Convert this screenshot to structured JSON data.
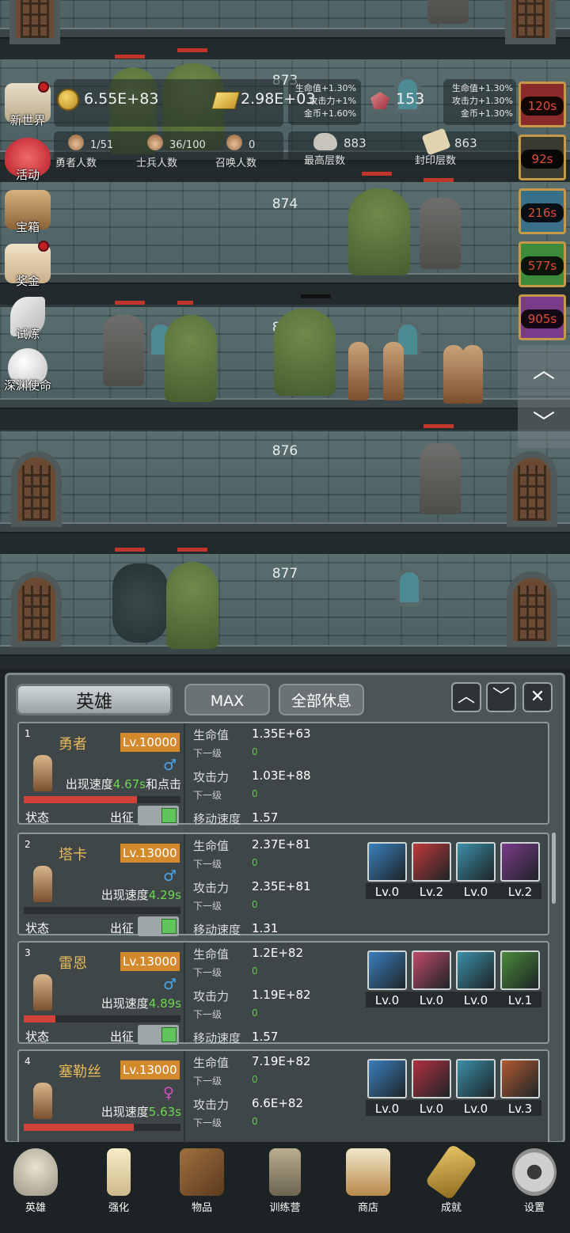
{
  "floors": [
    {
      "number": ""
    },
    {
      "number": "873"
    },
    {
      "number": "874"
    },
    {
      "number": "875"
    },
    {
      "number": "876"
    },
    {
      "number": "877"
    }
  ],
  "stats": {
    "gold": "6.55E+83",
    "goldbar": "2.98E+03",
    "goldbar_bonus": [
      "生命值+1.30%",
      "攻击力+1%",
      "金币+1.60%"
    ],
    "gem": "153",
    "gem_bonus": [
      "生命值+1.30%",
      "攻击力+1.30%",
      "金币+1.30%"
    ],
    "heroes": {
      "value": "1/51",
      "label": "勇者人数"
    },
    "soldiers": {
      "value": "36/100",
      "label": "士兵人数"
    },
    "summons": {
      "value": "0",
      "label": "召唤人数"
    },
    "highest": {
      "value": "883",
      "label": "最高层数"
    },
    "sealed": {
      "value": "863",
      "label": "封印层数"
    }
  },
  "left_menu": [
    {
      "label": "新世界",
      "icon": "map-icon",
      "badge": true
    },
    {
      "label": "活动",
      "icon": "heart-icon",
      "badge": false
    },
    {
      "label": "宝箱",
      "icon": "chest-icon",
      "badge": false
    },
    {
      "label": "奖金",
      "icon": "envelope-icon",
      "badge": true
    },
    {
      "label": "试炼",
      "icon": "feather-icon",
      "badge": false
    },
    {
      "label": "深渊使命",
      "icon": "orb-icon",
      "badge": false
    }
  ],
  "right_timers": [
    {
      "time": "120s",
      "color": "#8b2a2a"
    },
    {
      "time": "92s",
      "color": "#2a2a2a"
    },
    {
      "time": "216s",
      "color": "#3a6f8a"
    },
    {
      "time": "577s",
      "color": "#3c8a3a"
    },
    {
      "time": "905s",
      "color": "#7a3c8a"
    }
  ],
  "panel": {
    "title": "英雄",
    "max": "MAX",
    "rest_all": "全部休息"
  },
  "heroes": [
    {
      "idx": "1",
      "name": "勇者",
      "level": "Lv.10000",
      "gender": "♂",
      "gender_color": "#4fa3e6",
      "speed_prefix": "出现速度",
      "speed": "4.67s",
      "speed_suffix": "和点击",
      "hp_fill": 0.72,
      "status": "状态",
      "deploy": "出征",
      "hp_label": "生命值",
      "hp": "1.35E+63",
      "next1": "下一级",
      "next1_val": "0",
      "atk_label": "攻击力",
      "atk": "1.03E+88",
      "next2": "下一级",
      "next2_val": "0",
      "move_label": "移动速度",
      "move": "1.57",
      "skills": []
    },
    {
      "idx": "2",
      "name": "塔卡",
      "level": "Lv.13000",
      "gender": "♂",
      "gender_color": "#4fa3e6",
      "speed_prefix": "出现速度",
      "speed": "4.29s",
      "speed_suffix": "",
      "hp_fill": 0,
      "status": "状态",
      "deploy": "出征",
      "hp_label": "生命值",
      "hp": "2.37E+81",
      "next1": "下一级",
      "next1_val": "0",
      "atk_label": "攻击力",
      "atk": "2.35E+81",
      "next2": "下一级",
      "next2_val": "0",
      "move_label": "移动速度",
      "move": "1.31",
      "skills": [
        {
          "icon": "axe-icon",
          "lv": "Lv.0",
          "color": "#3a7fbf"
        },
        {
          "icon": "battle-axe-icon",
          "lv": "Lv.2",
          "color": "#c03a3a"
        },
        {
          "icon": "boots-icon",
          "lv": "Lv.0",
          "color": "#3a8fa8"
        },
        {
          "icon": "hammer-icon",
          "lv": "Lv.2",
          "color": "#7a3a8a"
        }
      ]
    },
    {
      "idx": "3",
      "name": "雷恩",
      "level": "Lv.13000",
      "gender": "♂",
      "gender_color": "#4fa3e6",
      "speed_prefix": "出现速度",
      "speed": "4.89s",
      "speed_suffix": "",
      "hp_fill": 0.2,
      "status": "状态",
      "deploy": "出征",
      "hp_label": "生命值",
      "hp": "1.2E+82",
      "next1": "下一级",
      "next1_val": "0",
      "atk_label": "攻击力",
      "atk": "1.19E+82",
      "next2": "下一级",
      "next2_val": "0",
      "move_label": "移动速度",
      "move": "1.57",
      "skills": [
        {
          "icon": "sword-icon",
          "lv": "Lv.0",
          "color": "#3a7fbf"
        },
        {
          "icon": "blade-icon",
          "lv": "Lv.0",
          "color": "#c04a6a"
        },
        {
          "icon": "boots-icon",
          "lv": "Lv.0",
          "color": "#3a8fa8"
        },
        {
          "icon": "leaf-icon",
          "lv": "Lv.1",
          "color": "#4a8a3a"
        }
      ]
    },
    {
      "idx": "4",
      "name": "塞勒丝",
      "level": "Lv.13000",
      "gender": "♀",
      "gender_color": "#d24fc0",
      "speed_prefix": "出现速度",
      "speed": "5.63s",
      "speed_suffix": "",
      "hp_fill": 0.7,
      "status": "",
      "deploy": "",
      "hp_label": "生命值",
      "hp": "7.19E+82",
      "next1": "下一级",
      "next1_val": "0",
      "atk_label": "攻击力",
      "atk": "6.6E+82",
      "next2": "下一级",
      "next2_val": "0",
      "move_label": "",
      "move": "",
      "skills": [
        {
          "icon": "shield-star-icon",
          "lv": "Lv.0",
          "color": "#3a7fbf"
        },
        {
          "icon": "monster-icon",
          "lv": "Lv.0",
          "color": "#b03040"
        },
        {
          "icon": "boots-icon",
          "lv": "Lv.0",
          "color": "#3a8fa8"
        },
        {
          "icon": "totem-icon",
          "lv": "Lv.3",
          "color": "#b05a30"
        }
      ]
    }
  ],
  "bottom_nav": [
    {
      "label": "英雄",
      "icon": "skull-icon"
    },
    {
      "label": "强化",
      "icon": "candle-icon"
    },
    {
      "label": "物品",
      "icon": "book-icon"
    },
    {
      "label": "训练营",
      "icon": "lantern-icon"
    },
    {
      "label": "商店",
      "icon": "mug-icon"
    },
    {
      "label": "成就",
      "icon": "key-icon"
    },
    {
      "label": "设置",
      "icon": "gear-icon"
    }
  ]
}
